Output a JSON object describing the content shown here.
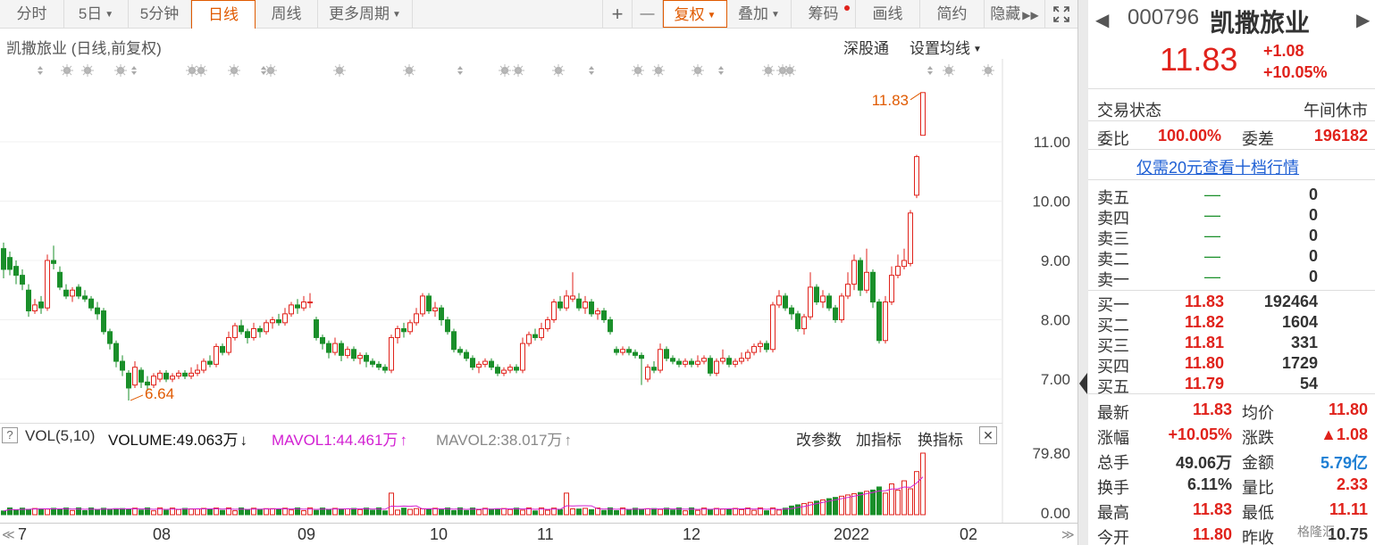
{
  "toolbar": {
    "tabs": [
      "分时",
      "5日",
      "5分钟",
      "日线",
      "周线",
      "更多周期"
    ],
    "active_tab": "日线",
    "plus": "+",
    "minus": "—",
    "fuquan": "复权",
    "diejia": "叠加",
    "chouma": "筹码",
    "huaxian": "画线",
    "jianyue": "简约",
    "yincang": "隐藏"
  },
  "chart": {
    "header": "凯撒旅业 (日线,前复权)",
    "link_sgt": "深股通",
    "link_ma": "设置均线",
    "high_label": "11.83",
    "low_label": "6.64",
    "y_ticks": [
      "11.00",
      "10.00",
      "9.00",
      "8.00",
      "7.00"
    ],
    "vol_ticks": [
      "79.80",
      "0.00"
    ],
    "x_ticks": [
      "7",
      "08",
      "09",
      "10",
      "11",
      "12",
      "2022",
      "02"
    ]
  },
  "volume_bar": {
    "help": "?",
    "label": "VOL(5,10)",
    "volume": "VOLUME:49.063万",
    "mavol1": "MAVOL1:44.461万",
    "mavol2": "MAVOL2:38.017万",
    "gai": "改参数",
    "jia": "加指标",
    "huan": "换指标",
    "close": "✕"
  },
  "colors": {
    "up": "#e0221b",
    "down": "#1a8f2a",
    "accent": "#e05a00",
    "mavol1": "#d21fd2"
  },
  "quote": {
    "code": "000796",
    "name": "凯撒旅业",
    "price": "11.83",
    "change": "+1.08",
    "change_pct": "+10.05%",
    "status_label": "交易状态",
    "status_value": "午间休市",
    "weibi_label": "委比",
    "weibi_value": "100.00%",
    "weicha_label": "委差",
    "weicha_value": "196182",
    "promo": "仅需20元查看十档行情",
    "sell": [
      {
        "label": "卖五",
        "price": "—",
        "vol": "0"
      },
      {
        "label": "卖四",
        "price": "—",
        "vol": "0"
      },
      {
        "label": "卖三",
        "price": "—",
        "vol": "0"
      },
      {
        "label": "卖二",
        "price": "—",
        "vol": "0"
      },
      {
        "label": "卖一",
        "price": "—",
        "vol": "0"
      }
    ],
    "buy": [
      {
        "label": "买一",
        "price": "11.83",
        "vol": "192464"
      },
      {
        "label": "买二",
        "price": "11.82",
        "vol": "1604"
      },
      {
        "label": "买三",
        "price": "11.81",
        "vol": "331"
      },
      {
        "label": "买四",
        "price": "11.80",
        "vol": "1729"
      },
      {
        "label": "买五",
        "price": "11.79",
        "vol": "54"
      }
    ],
    "stats": [
      {
        "l1": "最新",
        "v1": "11.83",
        "l2": "均价",
        "v2": "11.80"
      },
      {
        "l1": "涨幅",
        "v1": "+10.05%",
        "l2": "涨跌",
        "v2": "▲1.08"
      },
      {
        "l1": "总手",
        "v1": "49.06万",
        "l2": "金额",
        "v2": "5.79亿"
      },
      {
        "l1": "换手",
        "v1": "6.11%",
        "l2": "量比",
        "v2": "2.33"
      },
      {
        "l1": "最高",
        "v1": "11.83",
        "l2": "最低",
        "v2": "11.11"
      },
      {
        "l1": "今开",
        "v1": "11.80",
        "l2": "昨收",
        "v2": "10.75"
      }
    ],
    "watermark": "格隆汇"
  }
}
